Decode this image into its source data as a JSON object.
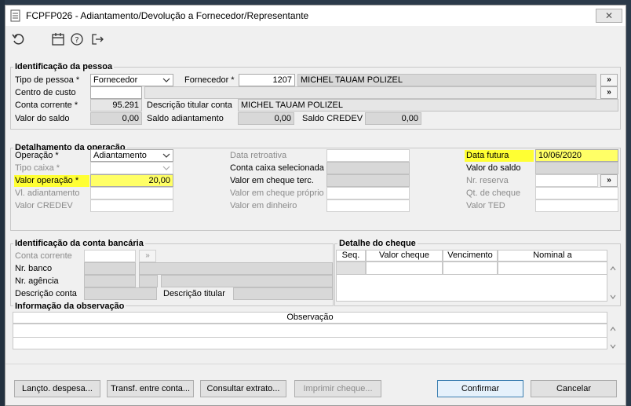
{
  "window": {
    "title": "FCPFP026 - Adiantamento/Devolução a Fornecedor/Representante",
    "close_label": "✕"
  },
  "toolbar": {
    "icons": [
      "undo-icon",
      "calendar-icon",
      "help-icon",
      "exit-icon"
    ]
  },
  "pessoa": {
    "title": "Identificação da pessoa",
    "tipo_label": "Tipo de pessoa *",
    "tipo_value": "Fornecedor",
    "fornecedor_label": "Fornecedor *",
    "fornecedor_code": "1207",
    "fornecedor_name": "MICHEL TAUAM POLIZEL",
    "lookup_btn": "»",
    "centro_label": "Centro de custo",
    "centro_value": "",
    "centro_desc": "",
    "conta_label": "Conta corrente *",
    "conta_value": "95.291",
    "desc_titular_label": "Descrição titular conta",
    "desc_titular_value": "MICHEL TAUAM POLIZEL",
    "saldo_label": "Valor do saldo",
    "saldo_value": "0,00",
    "saldo_adiant_label": "Saldo adiantamento",
    "saldo_adiant_value": "0,00",
    "saldo_credev_label": "Saldo CREDEV",
    "saldo_credev_value": "0,00"
  },
  "operacao": {
    "title": "Detalhamento da operação",
    "operacao_label": "Operação *",
    "operacao_value": "Adiantamento",
    "tipo_caixa_label": "Tipo caixa *",
    "valor_op_label": "Valor operação *",
    "valor_op_value": "20,00",
    "vl_adiant_label": "Vl. adiantamento",
    "valor_credev_label": "Valor CREDEV",
    "data_retro_label": "Data retroativa",
    "conta_caixa_label": "Conta caixa selecionada",
    "cheque_terc_label": "Valor em cheque terc.",
    "cheque_proprio_label": "Valor em cheque próprio",
    "dinheiro_label": "Valor em dinheiro",
    "data_futura_label": "Data futura",
    "data_futura_value": "10/06/2020",
    "valor_saldo_label": "Valor do saldo",
    "nr_reserva_label": "Nr. reserva",
    "qt_cheque_label": "Qt. de cheque",
    "valor_ted_label": "Valor TED"
  },
  "bancaria": {
    "title": "Identificação da conta bancária",
    "conta_label": "Conta corrente",
    "nr_banco_label": "Nr. banco",
    "nr_agencia_label": "Nr. agência",
    "desc_conta_label": "Descrição conta",
    "desc_titular_label": "Descrição titular"
  },
  "cheque": {
    "title": "Detalhe do cheque",
    "columns": [
      "Seq.",
      "Valor cheque",
      "Vencimento",
      "Nominal a"
    ]
  },
  "observacao": {
    "title": "Informação da observação",
    "column": "Observação"
  },
  "buttons": {
    "lancto": "Lançto. despesa...",
    "transf": "Transf. entre conta...",
    "consultar": "Consultar extrato...",
    "imprimir": "Imprimir cheque...",
    "confirmar": "Confirmar",
    "cancelar": "Cancelar"
  },
  "colors": {
    "highlight": "#ffff33",
    "focus_border": "#3c7fb1"
  }
}
